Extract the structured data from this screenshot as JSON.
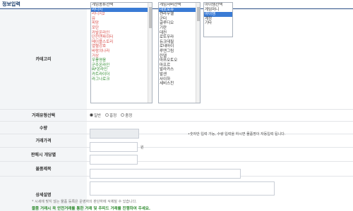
{
  "section": {
    "title": "정보입력"
  },
  "rows": {
    "category": "카테고리",
    "trade_type": "거래유형선택",
    "quantity": "수량",
    "price": "거래가격",
    "min_price": "판매시 개당별",
    "item_name": "물품제목",
    "detail": "상세설명"
  },
  "category": {
    "list1": [
      {
        "label": "게임종류선택",
        "color": "#333333",
        "selected": false
      },
      {
        "label": "리니지",
        "color": "#d9534f",
        "selected": true
      },
      {
        "label": "리니지2",
        "color": "#d9534f",
        "selected": false
      },
      {
        "label": "뮤",
        "color": "#d9534f",
        "selected": false
      },
      {
        "label": "피망",
        "color": "#d9534f",
        "selected": false
      },
      {
        "label": "포탄",
        "color": "#d9534f",
        "selected": false
      },
      {
        "label": "카발온라인",
        "color": "#d9534f",
        "selected": false
      },
      {
        "label": "던전앤파이터",
        "color": "#d9534f",
        "selected": false
      },
      {
        "label": "메이플스토리",
        "color": "#d9534f",
        "selected": false
      },
      {
        "label": "열혈강호",
        "color": "#d9534f",
        "selected": false
      },
      {
        "label": "바람의나라",
        "color": "#d9534f",
        "selected": false
      },
      {
        "label": "거상",
        "color": "#d9534f",
        "selected": false
      },
      {
        "label": "우풍영웅",
        "color": "#2e8b2e",
        "selected": false
      },
      {
        "label": "군주온라인",
        "color": "#2e8b2e",
        "selected": false
      },
      {
        "label": "RF온라인",
        "color": "#2e8b2e",
        "selected": false
      },
      {
        "label": "카트라이더",
        "color": "#2e8b2e",
        "selected": false
      },
      {
        "label": "라그나로크",
        "color": "#2e8b2e",
        "selected": false
      }
    ],
    "list2": [
      {
        "label": "게임서버선택",
        "selected": false
      },
      {
        "label": "데포로쥬",
        "selected": true
      },
      {
        "label": "켄라우헬",
        "selected": false
      },
      {
        "label": "군터",
        "selected": false
      },
      {
        "label": "글루디오",
        "selected": false
      },
      {
        "label": "기란",
        "selected": false
      },
      {
        "label": "데컨",
        "selected": false
      },
      {
        "label": "로또우라",
        "selected": false
      },
      {
        "label": "듀크데필",
        "selected": false
      },
      {
        "label": "로데마이",
        "selected": false
      },
      {
        "label": "루엔그림",
        "selected": false
      },
      {
        "label": "린델",
        "selected": false
      },
      {
        "label": "마쯔오토오",
        "selected": false
      },
      {
        "label": "마프르",
        "selected": false
      },
      {
        "label": "발라카스",
        "selected": false
      },
      {
        "label": "발센",
        "selected": false
      },
      {
        "label": "사이하",
        "selected": false
      },
      {
        "label": "세비스친",
        "selected": false
      }
    ],
    "list3": [
      {
        "label": "아이템선택",
        "selected": false
      },
      {
        "label": "게임머니",
        "selected": false
      },
      {
        "label": "아이템",
        "selected": true
      },
      {
        "label": "계정",
        "selected": false
      },
      {
        "label": "기타",
        "selected": false
      }
    ]
  },
  "trade": {
    "options": [
      "일반",
      "흥정",
      "충정"
    ],
    "selected": 0
  },
  "quantity": {
    "hint": "•숫자만 입력 가능, 수량 입력을 하시면 물품명이 자동입력 됩니다."
  },
  "price": {
    "unit": "원"
  },
  "footer": {
    "note": "* 시세에 맞지 않는 물품 등록은 운영자의 판단하에 삭제될 수 있습니다.",
    "warning": "물품 거래시 꼭 안전거래를 통한 거래 및 추피드 거래를 진행하여 주세요."
  }
}
